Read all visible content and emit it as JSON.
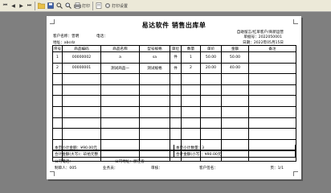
{
  "toolbar": {
    "items": [
      {
        "name": "first-page-icon",
        "glyph": "⏮"
      },
      {
        "name": "prev-page-icon",
        "glyph": "◀"
      },
      {
        "name": "next-page-icon",
        "glyph": "▶"
      },
      {
        "name": "last-page-icon",
        "glyph": "⏭"
      }
    ],
    "print_label": "打印",
    "print_settings_label": "打印设置"
  },
  "report": {
    "title": "易达软件 销售出库单",
    "company_line": "自助留言/红单客户/商新运营",
    "order_no_label": "单据号：",
    "order_no": "2022050001",
    "date_label": "日期：",
    "date": "2022年05月15日",
    "customer_label": "客户名称：",
    "customer": "曾明",
    "phone_label": "电话：",
    "phone": "",
    "address_label": "地址：",
    "address": "abcdz"
  },
  "table": {
    "headers": [
      "序号",
      "商品编码",
      "商品名称",
      "型号规格",
      "单位",
      "数量",
      "单价",
      "金额",
      "备注"
    ],
    "rows": [
      [
        "1",
        "00000002",
        "a",
        "sa",
        "件",
        "1",
        "50.00",
        "50.00",
        ""
      ],
      [
        "2",
        "00000001",
        "测试商品一",
        "测试规格",
        "件",
        "2",
        "20.00",
        "40.00",
        ""
      ]
    ],
    "empty_rows": 8
  },
  "summary": {
    "page_total_label": "本页小计金额：¥90.00元",
    "page_qty_label": "本页小计数量：3",
    "all_total_label": "合计金额(大写)：玖拾元整",
    "all_total_small_label": "合计金额(小写)：¥90.00元"
  },
  "footer": {
    "company_phone_label": "公司电话：",
    "company_phone": "",
    "company_addr_label": "公司地址：",
    "company_addr": "浙江省",
    "maker_label": "制单人：",
    "maker": "005",
    "salesman_label": "业务员：",
    "salesman": "",
    "reviewer_label": "审核：",
    "reviewer": "",
    "signature_label": "客户签名：",
    "signature": "",
    "page_label": "页：",
    "page_value": "1/1"
  }
}
